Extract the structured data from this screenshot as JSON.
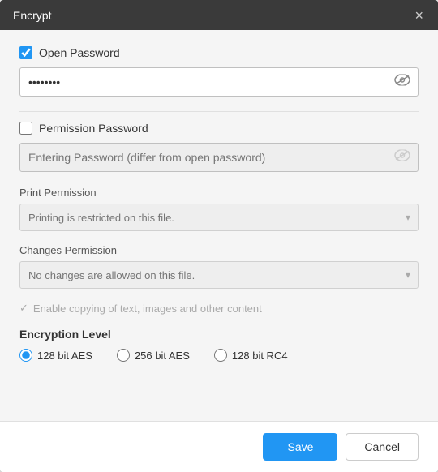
{
  "titleBar": {
    "title": "Encrypt",
    "closeIcon": "×"
  },
  "openPassword": {
    "checkboxLabel": "Open Password",
    "checked": true,
    "passwordValue": "••••••••",
    "eyeIcon": "👁"
  },
  "permissionPassword": {
    "checkboxLabel": "Permission Password",
    "checked": false,
    "placeholder": "Entering Password (differ from open password)",
    "eyeIcon": "👁"
  },
  "printPermission": {
    "label": "Print Permission",
    "placeholder": "Printing is restricted on this file.",
    "arrowIcon": "▾"
  },
  "changesPermission": {
    "label": "Changes Permission",
    "placeholder": "No changes are allowed on this file.",
    "arrowIcon": "▾"
  },
  "copyPermission": {
    "checkIcon": "✓",
    "label": "Enable copying of text, images and other content"
  },
  "encryptionLevel": {
    "title": "Encryption Level",
    "options": [
      {
        "value": "128aes",
        "label": "128 bit AES",
        "selected": true
      },
      {
        "value": "256aes",
        "label": "256 bit AES",
        "selected": false
      },
      {
        "value": "128rc4",
        "label": "128 bit RC4",
        "selected": false
      }
    ]
  },
  "footer": {
    "saveLabel": "Save",
    "cancelLabel": "Cancel"
  }
}
